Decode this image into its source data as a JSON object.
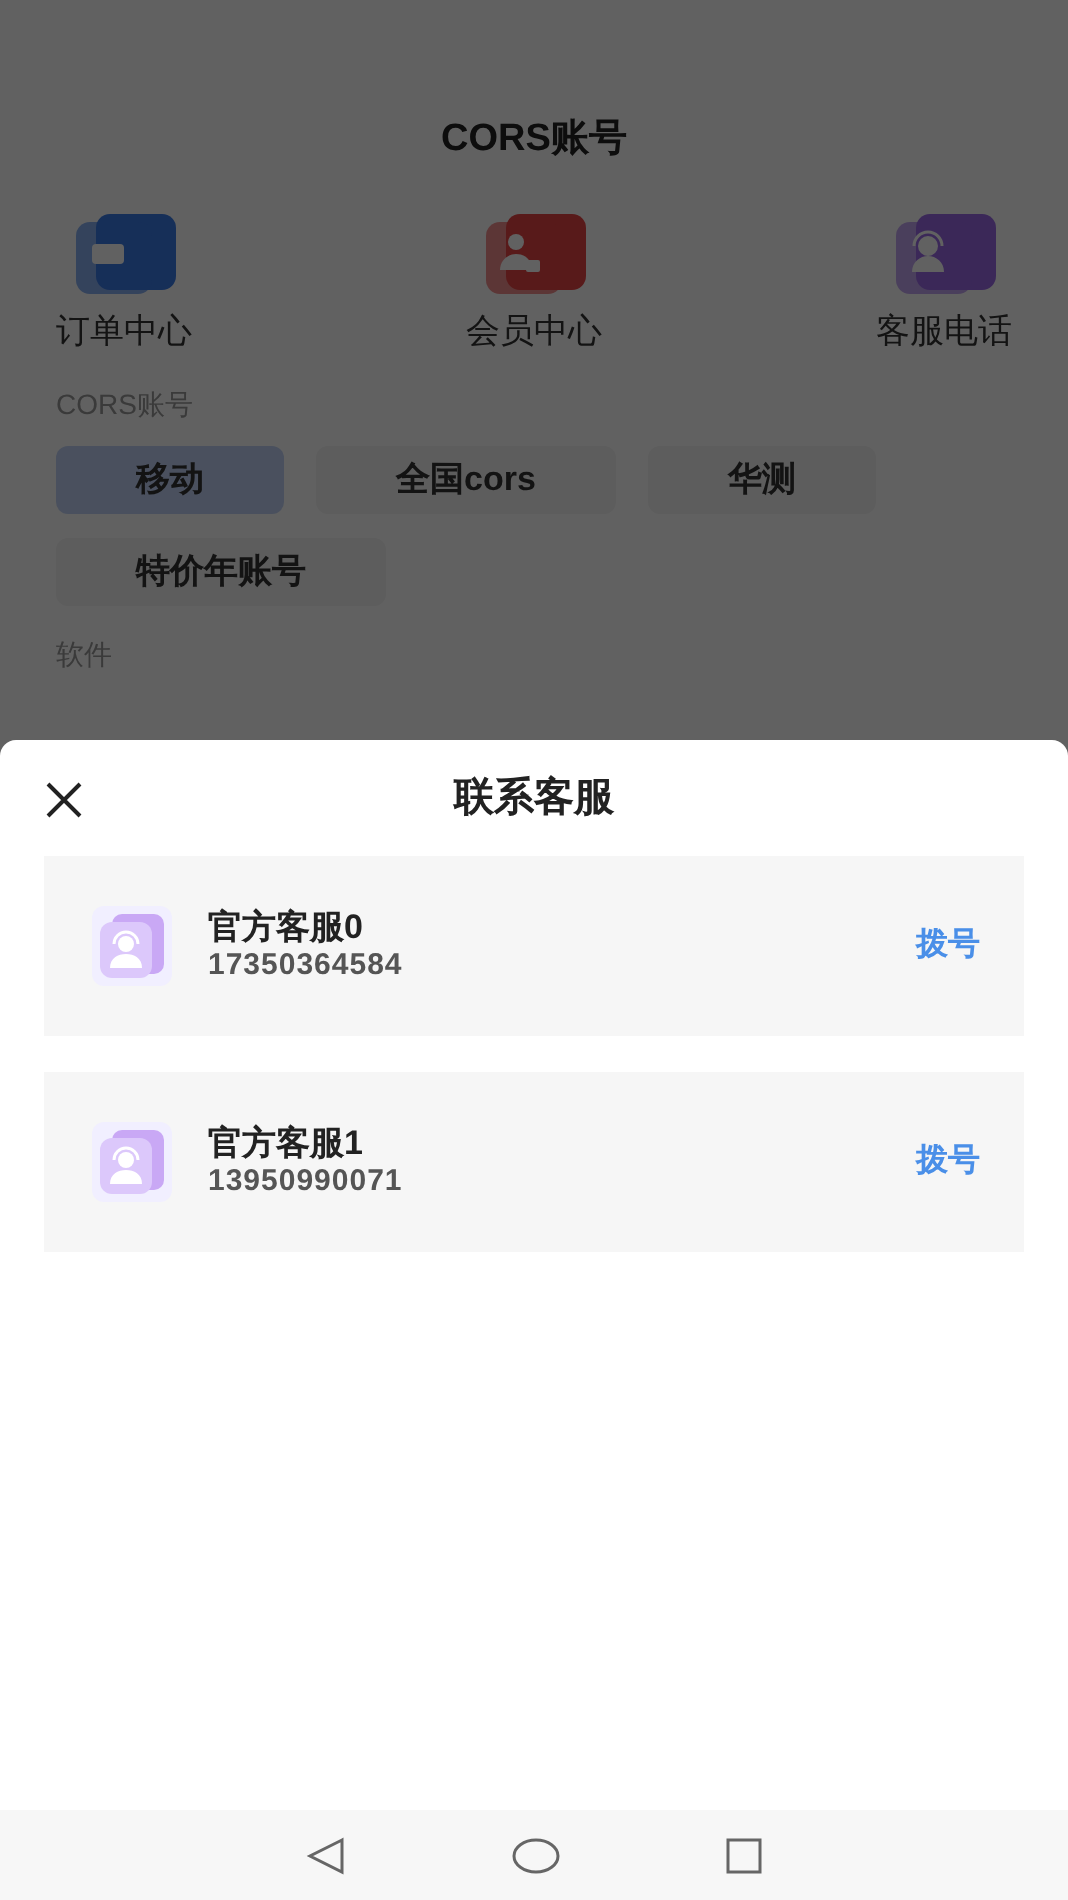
{
  "page": {
    "title": "CORS账号",
    "shortcuts": [
      {
        "label": "订单中心",
        "kind": "ticket"
      },
      {
        "label": "会员中心",
        "kind": "member"
      },
      {
        "label": "客服电话",
        "kind": "support"
      }
    ],
    "sections": [
      {
        "heading": "CORS账号",
        "chips": [
          {
            "label": "移动",
            "selected": true
          },
          {
            "label": "全国cors",
            "selected": false
          },
          {
            "label": "华测",
            "selected": false
          },
          {
            "label": "特价年账号",
            "selected": false
          }
        ]
      },
      {
        "heading": "软件"
      }
    ]
  },
  "sheet": {
    "title": "联系客服",
    "contacts": [
      {
        "name": "官方客服0",
        "phone": "17350364584",
        "action": "拨号"
      },
      {
        "name": "官方客服1",
        "phone": "13950990071",
        "action": "拨号"
      }
    ]
  }
}
